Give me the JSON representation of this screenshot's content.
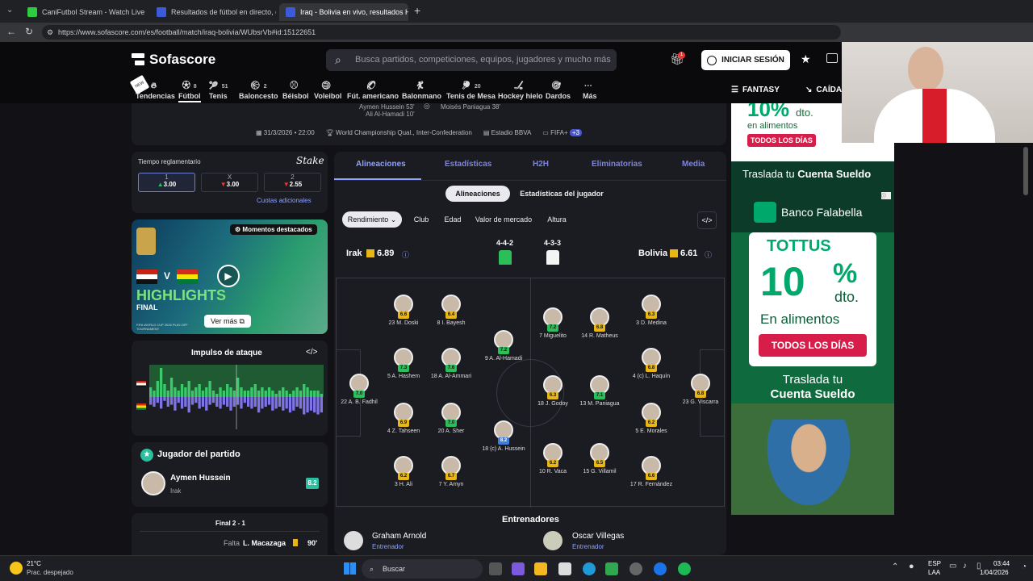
{
  "browser": {
    "tabs": [
      {
        "title": "CaniFutbol Stream - Watch Live or",
        "color": "#2ecc40"
      },
      {
        "title": "Resultados de fútbol en directo, c",
        "color": "#3b5bdb"
      },
      {
        "title": "Iraq - Bolivia en vivo, resultados H",
        "color": "#3b5bdb"
      }
    ],
    "new_tab": "+",
    "url": "https://www.sofascore.com/es/football/match/iraq-bolivia/WUbsrVb#id:15122651"
  },
  "header": {
    "logo": "Sofascore",
    "search_placeholder": "Busca partidos, competiciones, equipos, jugadores y mucho más",
    "gift_badge": "1",
    "login": "INICIAR SESIÓN",
    "fantasy": "FANTASY",
    "caida": "CAÍDA"
  },
  "sports": [
    {
      "label": "Tendencias",
      "count": ""
    },
    {
      "label": "Fútbol",
      "count": "8"
    },
    {
      "label": "Tenis",
      "count": "51"
    },
    {
      "label": "Baloncesto",
      "count": "2"
    },
    {
      "label": "Béisbol",
      "count": ""
    },
    {
      "label": "Voleibol",
      "count": ""
    },
    {
      "label": "Fút. americano",
      "count": ""
    },
    {
      "label": "Balonmano",
      "count": ""
    },
    {
      "label": "Tenis de Mesa",
      "count": "20"
    },
    {
      "label": "Hockey hielo",
      "count": ""
    },
    {
      "label": "Dardos",
      "count": ""
    },
    {
      "label": "Más",
      "count": ""
    }
  ],
  "match_info": {
    "scorers_home": [
      "Aymen Hussein 53'",
      "Ali Al-Hamadi 10'"
    ],
    "scorer_away": "Moisés Paniagua 38'",
    "date": "31/3/2026 • 22:00",
    "competition": "World Championship Qual., Inter-Confederation",
    "venue": "Estadio BBVA",
    "fifa": "FIFA+",
    "fifa_badge": "+3"
  },
  "odds": {
    "title": "Tiempo reglamentario",
    "brand": "Stake",
    "options": [
      {
        "label": "1",
        "value": "3.00"
      },
      {
        "label": "X",
        "value": "3.00"
      },
      {
        "label": "2",
        "value": "2.55"
      }
    ],
    "more": "Cuotas adicionales"
  },
  "highlights": {
    "badge": "Momentos destacados",
    "title": "HIGHLIGHTS",
    "subtitle": "FINAL",
    "caption": "FIFA WORLD CUP 2026 PLAY-OFF TOURNAMENT",
    "button": "Ver más",
    "vs": "V"
  },
  "attack": {
    "title": "Impulso de ataque",
    "home_values": [
      0.3,
      0.2,
      0.5,
      0.9,
      0.4,
      0.2,
      0.6,
      0.3,
      0.2,
      0.4,
      0.3,
      0.5,
      0.2,
      0.3,
      0.4,
      0.2,
      0.3,
      0.5,
      0.2,
      0.1,
      0.3,
      0.2,
      0.4,
      0.3,
      0.2,
      0.6,
      0.3,
      0.2,
      0.2,
      0.3,
      0.4,
      0.2,
      0.3,
      0.2,
      0.3,
      0.2,
      0.1,
      0.2,
      0.3,
      0.2,
      0.1,
      0.2,
      0.3,
      0.2,
      0.4,
      0.3,
      0.2,
      0.2,
      0.2,
      0.1
    ],
    "away_values": [
      0.4,
      0.5,
      0.3,
      0.6,
      0.2,
      0.5,
      0.4,
      0.7,
      0.3,
      0.6,
      0.5,
      0.8,
      0.4,
      0.3,
      0.6,
      0.5,
      0.7,
      0.4,
      0.3,
      0.5,
      0.6,
      0.4,
      0.5,
      0.7,
      0.5,
      0.4,
      0.6,
      0.3,
      0.5,
      0.6,
      0.5,
      0.8,
      0.6,
      0.5,
      0.4,
      0.7,
      0.6,
      0.5,
      0.7,
      0.6,
      0.8,
      0.7,
      0.5,
      0.6,
      0.9,
      0.8,
      0.7,
      0.8,
      0.9,
      0.8
    ]
  },
  "motm": {
    "title": "Jugador del partido",
    "name": "Aymen Hussein",
    "team": "Irak",
    "rating": "8.2"
  },
  "events": {
    "status": "Final 2 - 1",
    "foul_label": "Falta",
    "foul_player": "L. Macazaga",
    "minute": "90'"
  },
  "main_tabs": [
    "Alineaciones",
    "Estadísticas",
    "H2H",
    "Eliminatorias",
    "Media"
  ],
  "sub_tabs": [
    "Alineaciones",
    "Estadísticas del jugador"
  ],
  "filters": [
    "Rendimiento",
    "Club",
    "Edad",
    "Valor de mercado",
    "Altura"
  ],
  "teams": {
    "home": {
      "name": "Irak",
      "rating": "6.89",
      "formation": "4-4-2"
    },
    "away": {
      "name": "Bolivia",
      "rating": "6.61",
      "formation": "4-3-3"
    }
  },
  "players": [
    {
      "name": "22 A. B. Fadhil",
      "rating": "7.0",
      "c": "green"
    },
    {
      "name": "23 M. Doski",
      "rating": "6.6",
      "c": "yellow"
    },
    {
      "name": "5 A. Hashem",
      "rating": "7.3",
      "c": "green"
    },
    {
      "name": "4 Z. Tahseen",
      "rating": "6.9",
      "c": "yellow"
    },
    {
      "name": "3 H. Ali",
      "rating": "6.2",
      "c": "yellow"
    },
    {
      "name": "8 I. Bayesh",
      "rating": "6.4",
      "c": "yellow"
    },
    {
      "name": "18 A. Al-Ammari",
      "rating": "7.6",
      "c": "green"
    },
    {
      "name": "20 A. Sher",
      "rating": "7.0",
      "c": "green"
    },
    {
      "name": "7 Y. Amyn",
      "rating": "6.7",
      "c": "yellow"
    },
    {
      "name": "9 A. Al-Hamadi",
      "rating": "7.2",
      "c": "green"
    },
    {
      "name": "18 (c) A. Hussein",
      "rating": "8.2",
      "c": "blue"
    },
    {
      "name": "7 Miguelito",
      "rating": "7.2",
      "c": "green"
    },
    {
      "name": "18 J. Godoy",
      "rating": "6.3",
      "c": "yellow"
    },
    {
      "name": "10 R. Vaca",
      "rating": "6.2",
      "c": "yellow"
    },
    {
      "name": "14 R. Matheus",
      "rating": "6.8",
      "c": "yellow"
    },
    {
      "name": "13 M. Paniagua",
      "rating": "7.1",
      "c": "green"
    },
    {
      "name": "15 G. Villamil",
      "rating": "6.5",
      "c": "yellow"
    },
    {
      "name": "3 D. Medina",
      "rating": "6.3",
      "c": "yellow"
    },
    {
      "name": "4 (c) L. Haquín",
      "rating": "6.8",
      "c": "yellow"
    },
    {
      "name": "5 E. Morales",
      "rating": "6.2",
      "c": "yellow"
    },
    {
      "name": "17 R. Fernández",
      "rating": "6.6",
      "c": "yellow"
    },
    {
      "name": "23 G. Viscarra",
      "rating": "6.8",
      "c": "yellow"
    }
  ],
  "coaches": {
    "title": "Entrenadores",
    "home": {
      "name": "Graham Arnold",
      "role": "Entrenador"
    },
    "away": {
      "name": "Oscar Villegas",
      "role": "Entrenador"
    }
  },
  "ad": {
    "top_pct": "10%",
    "top_dto": "dto.",
    "top_line": "en alimentos",
    "top_pill": "TODOS LOS DÍAS",
    "traslada": "Traslada tu",
    "cuenta": "Cuenta Sueldo",
    "bank": "Banco Falabella",
    "tottus": "TOTTUS",
    "pct": "10",
    "pct_sym": "%",
    "dto": "dto.",
    "line": "En alimentos",
    "pill": "TODOS LOS DÍAS",
    "traslada2": "Traslada tu",
    "cuenta2": "Cuenta Sueldo"
  },
  "taskbar": {
    "temp": "21°C",
    "weather": "Prac. despejado",
    "search": "Buscar",
    "lang1": "ESP",
    "lang2": "LAA",
    "time": "03:44",
    "date": "1/04/2026"
  },
  "colors": {
    "accent": "#8ea2ff",
    "green": "#2bbf5a",
    "yellow": "#e9b713",
    "brand": "#4a57c9"
  }
}
